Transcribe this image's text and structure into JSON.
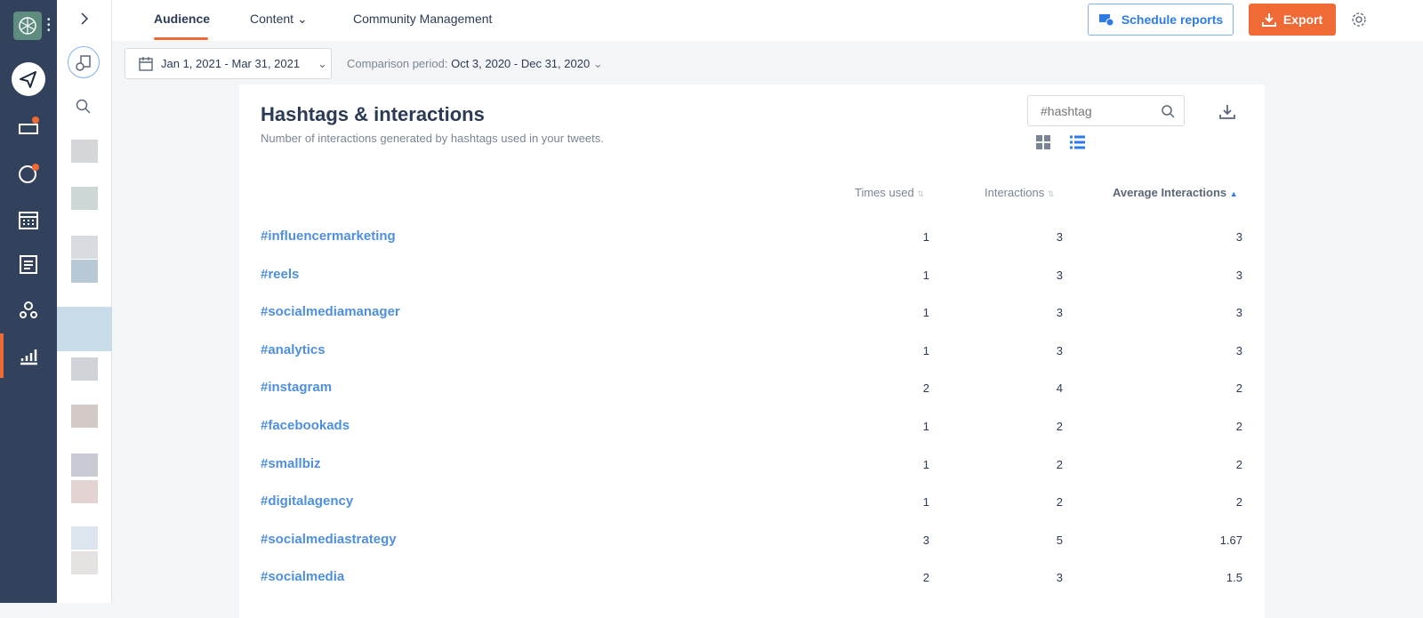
{
  "nav": {
    "tabs": [
      {
        "label": "Audience"
      },
      {
        "label": "Content"
      },
      {
        "label": "Community Management"
      }
    ],
    "schedule_label": "Schedule reports",
    "export_label": "Export"
  },
  "filters": {
    "date_range": "Jan 1, 2021 - Mar 31, 2021",
    "comparison_label": "Comparison period:",
    "comparison_value": "Oct 3, 2020 - Dec 31, 2020"
  },
  "card": {
    "title": "Hashtags & interactions",
    "subtitle": "Number of interactions generated by hashtags used in your tweets.",
    "search_placeholder": "#hashtag",
    "columns": [
      "Times used",
      "Interactions",
      "Average Interactions"
    ],
    "sorted_column": "Average Interactions",
    "rows": [
      [
        "#influencermarketing",
        "1",
        "3",
        "3"
      ],
      [
        "#reels",
        "1",
        "3",
        "3"
      ],
      [
        "#socialmediamanager",
        "1",
        "3",
        "3"
      ],
      [
        "#analytics",
        "1",
        "3",
        "3"
      ],
      [
        "#instagram",
        "2",
        "4",
        "2"
      ],
      [
        "#facebookads",
        "1",
        "2",
        "2"
      ],
      [
        "#smallbiz",
        "1",
        "2",
        "2"
      ],
      [
        "#digitalagency",
        "1",
        "2",
        "2"
      ],
      [
        "#socialmediastrategy",
        "3",
        "5",
        "1.67"
      ],
      [
        "#socialmedia",
        "2",
        "3",
        "1.5"
      ]
    ]
  },
  "colors": {
    "accent": "#f06a35",
    "link": "#4f8fdc",
    "rail": "#33425c",
    "primary_blue": "#2f7be5"
  }
}
